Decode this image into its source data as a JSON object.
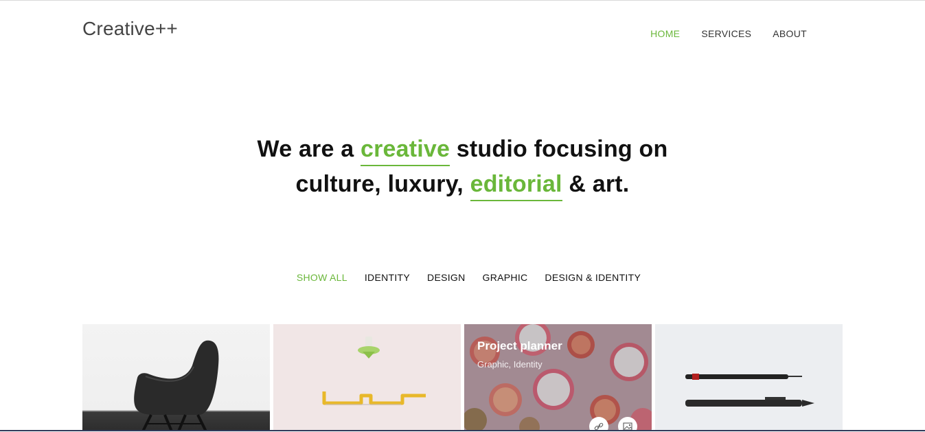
{
  "header": {
    "logo": "Creative++",
    "nav": [
      {
        "label": "HOME",
        "active": true
      },
      {
        "label": "SERVICES",
        "active": false
      },
      {
        "label": "ABOUT",
        "active": false
      }
    ]
  },
  "hero": {
    "line1_a": "We are a ",
    "line1_hl": "creative",
    "line1_b": " studio focusing on",
    "line2_a": "culture, luxury, ",
    "line2_hl": "editorial",
    "line2_b": " & art."
  },
  "filters": [
    {
      "label": "SHOW ALL",
      "active": true
    },
    {
      "label": "IDENTITY",
      "active": false
    },
    {
      "label": "DESIGN",
      "active": false
    },
    {
      "label": "GRAPHIC",
      "active": false
    },
    {
      "label": "DESIGN & IDENTITY",
      "active": false
    }
  ],
  "portfolio": {
    "items": [
      {
        "image": "black-chair-photo"
      },
      {
        "image": "yellow-shelf-photo"
      },
      {
        "image": "citrus-fruits-photo",
        "title": "Project planner",
        "categories": "Graphic, Identity",
        "actions": [
          "link-icon",
          "image-icon"
        ]
      },
      {
        "image": "pens-photo"
      }
    ]
  },
  "colors": {
    "accent": "#6ab73a",
    "text": "#111111",
    "logo": "#444444"
  }
}
